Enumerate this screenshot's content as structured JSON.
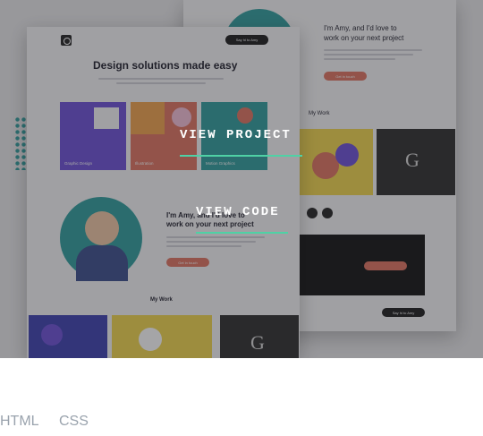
{
  "overlay": {
    "view_project": "VIEW PROJECT",
    "view_code": "VIEW CODE"
  },
  "tags": [
    "HTML",
    "CSS"
  ],
  "preview": {
    "front": {
      "nav_button": "Say hi to Amy",
      "hero_title": "Design solutions made easy",
      "tiles": [
        "Graphic Design",
        "Illustration",
        "Motion Graphics"
      ],
      "intro_title_line1": "I'm Amy, and I'd love to",
      "intro_title_line2": "work on your next project",
      "cta": "Get in touch",
      "section_title": "My Work"
    },
    "back": {
      "intro_title_line1": "I'm Amy, and I'd love to",
      "intro_title_line2": "work on your next project",
      "cta": "Get in touch",
      "section_title": "My Work",
      "book_letter": "G",
      "footer_button": "Say hi to Amy"
    }
  },
  "colors": {
    "accent_underline": "#4fd1a5",
    "tag_text": "#9aa3ad",
    "orange": "#e0735f",
    "purple": "#6b4fd8",
    "teal": "#2e9e9e"
  }
}
